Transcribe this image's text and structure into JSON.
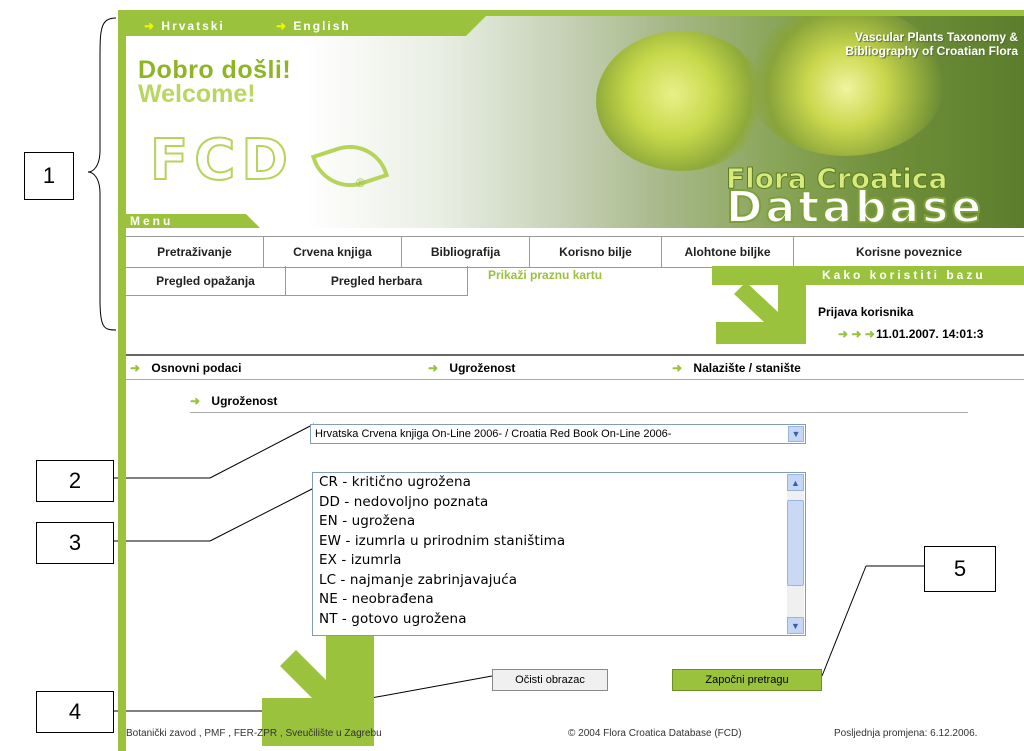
{
  "header": {
    "lang_hr": "Hrvatski",
    "lang_en": "English",
    "welcome_hr": "Dobro došli!",
    "welcome_en": "Welcome!",
    "logo": "FCD",
    "reg": "®",
    "tagline_1": "Vascular Plants Taxonomy &",
    "tagline_2": "Bibliography of Croatian Flora",
    "brand_1": "Flora Croatica",
    "brand_2": "Database",
    "menu_label": "Menu"
  },
  "menu": {
    "row1": [
      "Pretraživanje",
      "Crvena knjiga",
      "Bibliografija",
      "Korisno bilje",
      "Alohtone biljke",
      "Korisne poveznice"
    ],
    "row2": [
      "Pregled opažanja",
      "Pregled herbara"
    ],
    "active": "Prikaži praznu kartu",
    "howto": "Kako koristiti bazu"
  },
  "login": {
    "title": "Prijava korisnika",
    "datetime": "11.01.2007. 14:01:3"
  },
  "subnav": [
    "Osnovni podaci",
    "Ugroženost",
    "Nalazište / stanište"
  ],
  "section": {
    "title": "Ugroženost",
    "select_value": "Hrvatska Crvena knjiga On-Line 2006- / Croatia Red Book On-Line 2006-",
    "list": [
      "CR - kritično ugrožena",
      "DD - nedovoljno poznata",
      "EN - ugrožena",
      "EW - izumrla u prirodnim staništima",
      "EX - izumrla",
      "LC - najmanje zabrinjavajuća",
      "NE - neobrađena",
      "NT - gotovo ugrožena"
    ]
  },
  "buttons": {
    "clear": "Očisti obrazac",
    "start": "Započni pretragu"
  },
  "footer": {
    "left": "Botanički zavod , PMF , FER-ZPR , Sveučilište u Zagrebu",
    "center": "© 2004 Flora Croatica Database (FCD)",
    "right": "Posljednja promjena: 6.12.2006."
  },
  "callouts": [
    "1",
    "2",
    "3",
    "4",
    "5"
  ],
  "colors": {
    "accent": "#9ac23c"
  }
}
